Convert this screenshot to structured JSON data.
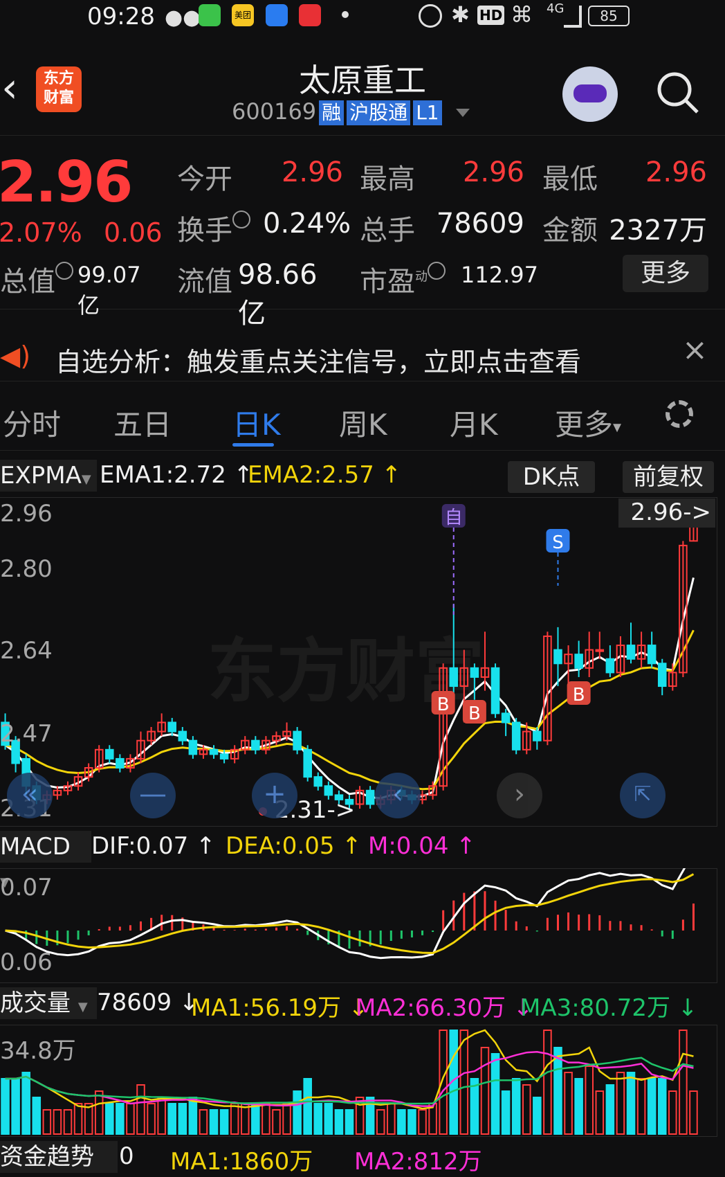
{
  "status_bar": {
    "time": "09:28",
    "battery": "85",
    "network": "4G",
    "icons": [
      "wechat-icon",
      "message-icon",
      "meituan-icon",
      "app-icon",
      "huawei-icon",
      "alarm-icon",
      "bluetooth-icon",
      "hd-icon",
      "wifi-icon",
      "signal-icon",
      "battery-icon"
    ],
    "meituan_label": "美团"
  },
  "header": {
    "back_icon": "back-arrow-icon",
    "logo_text": "东方\n财富",
    "stock_name": "太原重工",
    "stock_code": "600169",
    "badges": [
      "融",
      "沪股通",
      "L1"
    ],
    "search_icon": "search-icon"
  },
  "quote": {
    "price": "2.96",
    "change_pct": "2.07%",
    "change": "0.06",
    "open_label": "今开",
    "open": "2.96",
    "high_label": "最高",
    "high": "2.96",
    "low_label": "最低",
    "low": "2.96",
    "turnover_label": "换手",
    "turnover": "0.24%",
    "volume_label": "总手",
    "volume": "78609",
    "amount_label": "金额",
    "amount": "2327万",
    "mktcap_label": "总值",
    "mktcap": "99.07亿",
    "float_label": "流值",
    "float_cap": "98.66亿",
    "pe_label": "市盈",
    "pe_sup": "动",
    "pe": "112.97",
    "more_label": "更多"
  },
  "banner": {
    "text": "自选分析：触发重点关注信号，立即点击查看",
    "close_icon": "close-icon"
  },
  "tabs": {
    "items": [
      "分时",
      "五日",
      "日K",
      "周K",
      "月K",
      "更多"
    ],
    "active": "日K",
    "settings_icon": "gear-icon"
  },
  "main_chart": {
    "indicator": "EXPMA",
    "ema1": "EMA1:2.72",
    "ema2": "EMA2:2.57",
    "dk_label": "DK点",
    "adj_label": "前复权",
    "y_labels": [
      "2.96",
      "2.80",
      "2.64",
      "2.47",
      "2.31"
    ],
    "current_marker": "2.96->",
    "low_marker": "2.31->",
    "watermark": "东方财富",
    "self_tag": "自",
    "sell_tag": "S",
    "buy_tag": "B"
  },
  "macd": {
    "indicator": "MACD",
    "dif": "DIF:0.07",
    "dea": "DEA:0.05",
    "m": "M:0.04",
    "y_labels": [
      "0.07",
      "0.06"
    ]
  },
  "volume": {
    "indicator": "成交量",
    "value": "78609",
    "ma1": "MA1:56.19万",
    "ma2": "MA2:66.30万",
    "ma3": "MA3:80.72万",
    "y_label": "34.8万"
  },
  "fund_flow": {
    "indicator": "资金趋势",
    "value": "0",
    "ma1": "MA1:1860万",
    "ma2": "MA2:812万"
  },
  "colors": {
    "up": "#ff3b3b",
    "down": "#18e0ec",
    "ema1": "#ffffff",
    "ema2": "#f2d40a",
    "accent": "#2f7bea",
    "magenta": "#ff2fd7",
    "green": "#1ec46a"
  },
  "chart_data": {
    "type": "candlestick",
    "title": "",
    "ylim": [
      2.31,
      2.96
    ],
    "candles": [
      [
        2.5,
        2.45,
        2.52,
        2.44
      ],
      [
        2.46,
        2.41,
        2.47,
        2.39
      ],
      [
        2.42,
        2.36,
        2.43,
        2.34
      ],
      [
        2.36,
        2.33,
        2.37,
        2.32
      ],
      [
        2.33,
        2.34,
        2.35,
        2.32
      ],
      [
        2.34,
        2.35,
        2.36,
        2.33
      ],
      [
        2.35,
        2.36,
        2.37,
        2.34
      ],
      [
        2.36,
        2.38,
        2.39,
        2.35
      ],
      [
        2.38,
        2.4,
        2.41,
        2.37
      ],
      [
        2.4,
        2.44,
        2.45,
        2.39
      ],
      [
        2.44,
        2.42,
        2.45,
        2.41
      ],
      [
        2.42,
        2.4,
        2.43,
        2.39
      ],
      [
        2.4,
        2.42,
        2.43,
        2.39
      ],
      [
        2.42,
        2.46,
        2.48,
        2.41
      ],
      [
        2.46,
        2.48,
        2.49,
        2.45
      ],
      [
        2.48,
        2.5,
        2.52,
        2.47
      ],
      [
        2.5,
        2.48,
        2.51,
        2.47
      ],
      [
        2.48,
        2.46,
        2.49,
        2.45
      ],
      [
        2.46,
        2.43,
        2.47,
        2.42
      ],
      [
        2.43,
        2.44,
        2.45,
        2.42
      ],
      [
        2.44,
        2.43,
        2.45,
        2.42
      ],
      [
        2.43,
        2.42,
        2.44,
        2.41
      ],
      [
        2.42,
        2.44,
        2.45,
        2.41
      ],
      [
        2.44,
        2.46,
        2.47,
        2.43
      ],
      [
        2.46,
        2.44,
        2.47,
        2.43
      ],
      [
        2.44,
        2.46,
        2.47,
        2.43
      ],
      [
        2.46,
        2.47,
        2.48,
        2.45
      ],
      [
        2.47,
        2.48,
        2.5,
        2.46
      ],
      [
        2.48,
        2.44,
        2.49,
        2.43
      ],
      [
        2.44,
        2.38,
        2.45,
        2.37
      ],
      [
        2.38,
        2.36,
        2.39,
        2.35
      ],
      [
        2.36,
        2.34,
        2.37,
        2.33
      ],
      [
        2.34,
        2.33,
        2.35,
        2.32
      ],
      [
        2.33,
        2.32,
        2.34,
        2.31
      ],
      [
        2.32,
        2.35,
        2.36,
        2.31
      ],
      [
        2.35,
        2.32,
        2.36,
        2.31
      ],
      [
        2.32,
        2.33,
        2.34,
        2.31
      ],
      [
        2.33,
        2.35,
        2.36,
        2.32
      ],
      [
        2.35,
        2.34,
        2.36,
        2.33
      ],
      [
        2.34,
        2.33,
        2.35,
        2.32
      ],
      [
        2.33,
        2.34,
        2.35,
        2.32
      ],
      [
        2.34,
        2.36,
        2.37,
        2.33
      ],
      [
        2.36,
        2.62,
        2.63,
        2.35
      ],
      [
        2.62,
        2.58,
        2.76,
        2.56
      ],
      [
        2.58,
        2.62,
        2.66,
        2.5
      ],
      [
        2.62,
        2.6,
        2.63,
        2.55
      ],
      [
        2.6,
        2.62,
        2.7,
        2.57
      ],
      [
        2.62,
        2.52,
        2.63,
        2.51
      ],
      [
        2.52,
        2.5,
        2.53,
        2.47
      ],
      [
        2.5,
        2.44,
        2.51,
        2.43
      ],
      [
        2.44,
        2.48,
        2.5,
        2.43
      ],
      [
        2.48,
        2.46,
        2.49,
        2.44
      ],
      [
        2.46,
        2.69,
        2.7,
        2.45
      ],
      [
        2.66,
        2.63,
        2.71,
        2.58
      ],
      [
        2.63,
        2.65,
        2.67,
        2.58
      ],
      [
        2.65,
        2.62,
        2.68,
        2.6
      ],
      [
        2.62,
        2.66,
        2.7,
        2.6
      ],
      [
        2.66,
        2.66,
        2.7,
        2.64
      ],
      [
        2.64,
        2.61,
        2.67,
        2.6
      ],
      [
        2.61,
        2.67,
        2.69,
        2.6
      ],
      [
        2.67,
        2.64,
        2.72,
        2.63
      ],
      [
        2.64,
        2.67,
        2.7,
        2.62
      ],
      [
        2.67,
        2.63,
        2.7,
        2.62
      ],
      [
        2.63,
        2.58,
        2.64,
        2.56
      ],
      [
        2.58,
        2.61,
        2.63,
        2.57
      ],
      [
        2.61,
        2.89,
        2.9,
        2.6
      ],
      [
        2.9,
        2.96,
        2.96,
        2.9
      ]
    ]
  }
}
